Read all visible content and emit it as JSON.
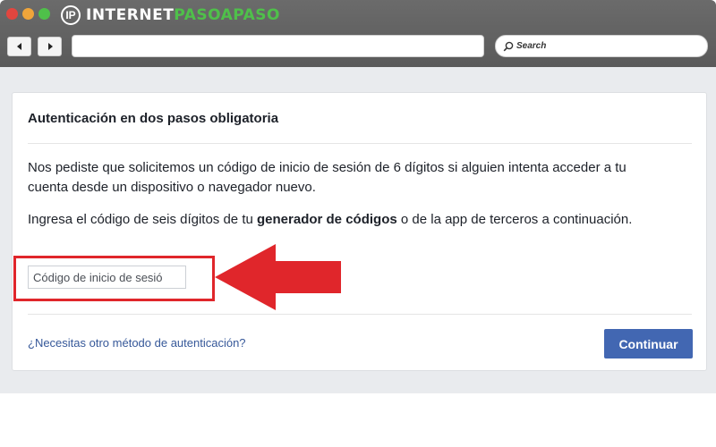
{
  "browser": {
    "logo_text_white": "INTERNET",
    "logo_text_green": "PASOAPASO",
    "logo_mark": "IP",
    "search_label": "Search",
    "icons": {
      "back": "arrow-left-icon",
      "forward": "arrow-right-icon",
      "search": "magnifier-icon"
    }
  },
  "dialog": {
    "title": "Autenticación en dos pasos obligatoria",
    "paragraph1": "Nos pediste que solicitemos un código de inicio de sesión de 6 dígitos si alguien intenta acceder a tu cuenta desde un dispositivo o navegador nuevo.",
    "paragraph2_before": "Ingresa el código de seis dígitos de tu ",
    "paragraph2_bold": "generador de códigos",
    "paragraph2_after": " o de la app de terceros a continuación.",
    "code_input_placeholder": "Código de inicio de sesió",
    "help_link": "¿Necesitas otro método de autenticación?",
    "continue_button": "Continuar"
  },
  "colors": {
    "accent_blue": "#4267b2",
    "link_blue": "#365899",
    "annotation_red": "#e0262b",
    "logo_green": "#4fc04a"
  }
}
